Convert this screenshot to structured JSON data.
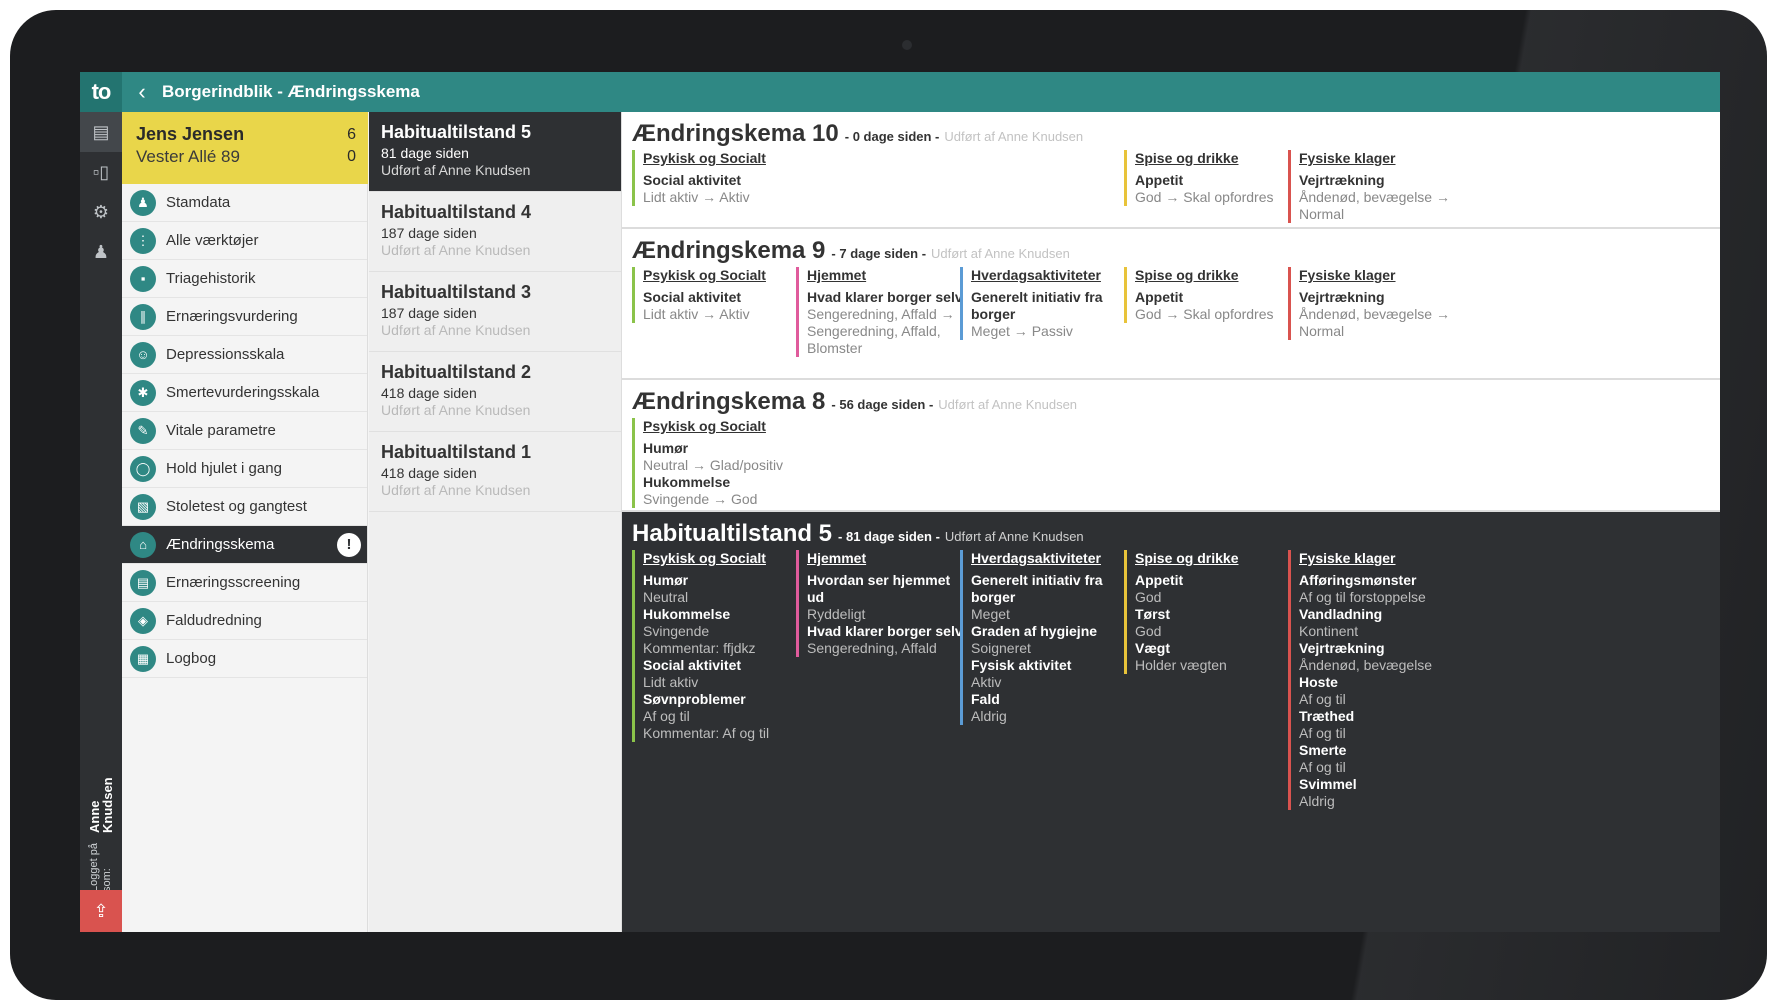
{
  "app": {
    "logo": "to",
    "back_icon": "chevron-left-icon",
    "title": "Borgerindblik - Ændringsskema"
  },
  "rail": {
    "items": [
      "tablet-icon",
      "chart-icon",
      "gear-icon",
      "person-icon"
    ],
    "logged_label": "Logget på som:",
    "logged_user": "Anne Knudsen",
    "logout_icon": "logout-icon"
  },
  "citizen": {
    "name": "Jens Jensen",
    "address": "Vester Allé 89",
    "count1": "6",
    "count2": "0"
  },
  "nav": [
    {
      "label": "Stamdata",
      "icon": "person-icon"
    },
    {
      "label": "Alle værktøjer",
      "icon": "grid-icon"
    },
    {
      "label": "Triagehistorik",
      "icon": "chart-icon"
    },
    {
      "label": "Ernæringsvurdering",
      "icon": "cutlery-icon"
    },
    {
      "label": "Depressionsskala",
      "icon": "face-icon"
    },
    {
      "label": "Smertevurderingsskala",
      "icon": "body-icon"
    },
    {
      "label": "Vitale parametre",
      "icon": "pencil-icon"
    },
    {
      "label": "Hold hjulet i gang",
      "icon": "wheel-icon"
    },
    {
      "label": "Stoletest og gangtest",
      "icon": "chair-icon"
    },
    {
      "label": "Ændringsskema",
      "icon": "house-icon",
      "alert": "!"
    },
    {
      "label": "Ernæringsscreening",
      "icon": "clipboard-icon"
    },
    {
      "label": "Faldudredning",
      "icon": "fall-icon"
    },
    {
      "label": "Logbog",
      "icon": "book-icon"
    }
  ],
  "versions": [
    {
      "title": "Habitualtilstand 5",
      "days": "81 dage siden",
      "by": "Udført af Anne Knudsen"
    },
    {
      "title": "Habitualtilstand 4",
      "days": "187 dage siden",
      "by": "Udført af Anne Knudsen"
    },
    {
      "title": "Habitualtilstand 3",
      "days": "187 dage siden",
      "by": "Udført af Anne Knudsen"
    },
    {
      "title": "Habitualtilstand 2",
      "days": "418 dage siden",
      "by": "Udført af Anne Knudsen"
    },
    {
      "title": "Habitualtilstand 1",
      "days": "418 dage siden",
      "by": "Udført af Anne Knudsen"
    }
  ],
  "sections": [
    {
      "title": "Ændringskema 10",
      "days": "- 0 dage siden -",
      "by": "Udført af Anne Knudsen",
      "cols": [
        {
          "cat": "Psykisk og Socialt",
          "items": [
            [
              "Social aktivitet",
              "Lidt aktiv → Aktiv"
            ]
          ]
        },
        {
          "cat": "Spise og drikke",
          "items": [
            [
              "Appetit",
              "God → Skal opfordres"
            ]
          ]
        },
        {
          "cat": "Fysiske klager",
          "items": [
            [
              "Vejrtrækning",
              "Åndenød, bevægelse → Normal"
            ]
          ]
        }
      ]
    },
    {
      "title": "Ændringskema 9",
      "days": "- 7 dage siden -",
      "by": "Udført af Anne Knudsen",
      "cols": [
        {
          "cat": "Psykisk og Socialt",
          "items": [
            [
              "Social aktivitet",
              "Lidt aktiv → Aktiv"
            ]
          ]
        },
        {
          "cat": "Hjemmet",
          "items": [
            [
              "Hvad klarer borger selv",
              "Sengeredning, Affald → Sengeredning, Affald, Blomster"
            ]
          ]
        },
        {
          "cat": "Hverdagsaktiviteter",
          "items": [
            [
              "Generelt initiativ fra borger",
              "Meget → Passiv"
            ]
          ]
        },
        {
          "cat": "Spise og drikke",
          "items": [
            [
              "Appetit",
              "God → Skal opfordres"
            ]
          ]
        },
        {
          "cat": "Fysiske klager",
          "items": [
            [
              "Vejrtrækning",
              "Åndenød, bevægelse → Normal"
            ]
          ]
        }
      ]
    },
    {
      "title": "Ændringskema 8",
      "days": "- 56 dage siden -",
      "by": "Udført af Anne Knudsen",
      "cols": [
        {
          "cat": "Psykisk og Socialt",
          "items": [
            [
              "Humør",
              "Neutral → Glad/positiv"
            ],
            [
              "Hukommelse",
              "Svingende → God"
            ]
          ]
        }
      ]
    },
    {
      "title": "Habitualtilstand 5",
      "days": "- 81 dage siden -",
      "by": "Udført af Anne Knudsen",
      "cols": [
        {
          "cat": "Psykisk og Socialt",
          "items": [
            [
              "Humør",
              "Neutral"
            ],
            [
              "Hukommelse",
              "Svingende"
            ],
            [
              "",
              "Kommentar: ffjdkz"
            ],
            [
              "Social aktivitet",
              "Lidt aktiv"
            ],
            [
              "Søvnproblemer",
              "Af og til"
            ],
            [
              "",
              "Kommentar: Af og til"
            ]
          ]
        },
        {
          "cat": "Hjemmet",
          "items": [
            [
              "Hvordan ser hjemmet ud",
              "Ryddeligt"
            ],
            [
              "Hvad klarer borger selv",
              "Sengeredning, Affald"
            ]
          ]
        },
        {
          "cat": "Hverdagsaktiviteter",
          "items": [
            [
              "Generelt initiativ fra borger",
              "Meget"
            ],
            [
              "Graden af hygiejne",
              "Soigneret"
            ],
            [
              "Fysisk aktivitet",
              "Aktiv"
            ],
            [
              "Fald",
              "Aldrig"
            ]
          ]
        },
        {
          "cat": "Spise og drikke",
          "items": [
            [
              "Appetit",
              "God"
            ],
            [
              "Tørst",
              "God"
            ],
            [
              "Vægt",
              "Holder vægten"
            ]
          ]
        },
        {
          "cat": "Fysiske klager",
          "items": [
            [
              "Afføringsmønster",
              "Af og til forstoppelse"
            ],
            [
              "Vandladning",
              "Kontinent"
            ],
            [
              "Vejrtrækning",
              "Åndenød, bevægelse"
            ],
            [
              "Hoste",
              "Af og til"
            ],
            [
              "Træthed",
              "Af og til"
            ],
            [
              "Smerte",
              "Af og til"
            ],
            [
              "Svimmel",
              "Aldrig"
            ]
          ]
        }
      ]
    }
  ]
}
